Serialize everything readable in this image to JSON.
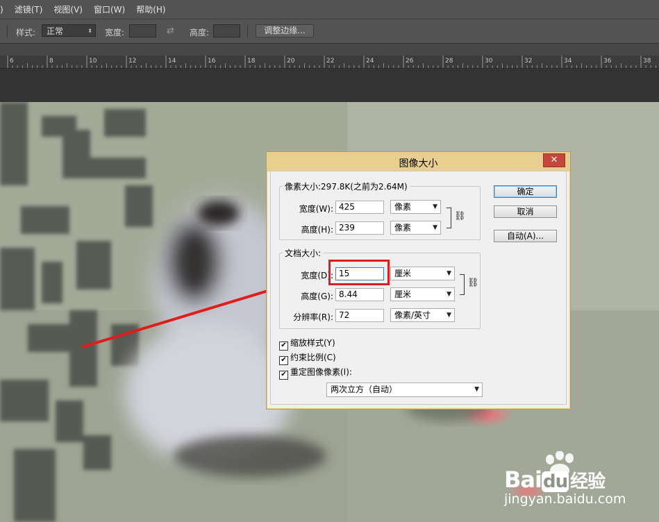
{
  "menubar": {
    "items": [
      ")",
      "滤镜(T)",
      "视图(V)",
      "窗口(W)",
      "帮助(H)"
    ]
  },
  "options_bar": {
    "style_label": "样式:",
    "style_value": "正常",
    "width_label": "宽度:",
    "height_label": "高度:",
    "refine_button": "调整边缘..."
  },
  "ruler": {
    "ticks": [
      "6",
      "8",
      "10",
      "12",
      "14",
      "16",
      "18",
      "20",
      "22",
      "24",
      "26",
      "28",
      "30",
      "32",
      "34",
      "36",
      "38"
    ]
  },
  "dialog": {
    "title": "图像大小",
    "close_label": "✕",
    "pixel_group": {
      "title": "像素大小:297.8K(之前为2.64M)",
      "width_label": "宽度(W):",
      "width_value": "425",
      "width_unit": "像素",
      "height_label": "高度(H):",
      "height_value": "239",
      "height_unit": "像素"
    },
    "document_group": {
      "title": "文档大小:",
      "width_label": "宽度(D):",
      "width_value": "15",
      "width_unit": "厘米",
      "height_label": "高度(G):",
      "height_value": "8.44",
      "height_unit": "厘米",
      "resolution_label": "分辨率(R):",
      "resolution_value": "72",
      "resolution_unit": "像素/英寸"
    },
    "checkboxes": [
      {
        "label": "缩放样式(Y)",
        "checked": true
      },
      {
        "label": "约束比例(C)",
        "checked": true
      },
      {
        "label": "重定图像像素(I):",
        "checked": true
      }
    ],
    "resample_method": "两次立方（自动）",
    "buttons": {
      "ok": "确定",
      "cancel": "取消",
      "auto": "自动(A)..."
    }
  },
  "watermark": {
    "brand": "Bai",
    "brand2": "du",
    "product": "经验",
    "url": "jingyan.baidu.com"
  },
  "colors": {
    "highlight": "#e01d1d",
    "dialog_title": "#e8cf8f",
    "close_button": "#c7463b"
  }
}
